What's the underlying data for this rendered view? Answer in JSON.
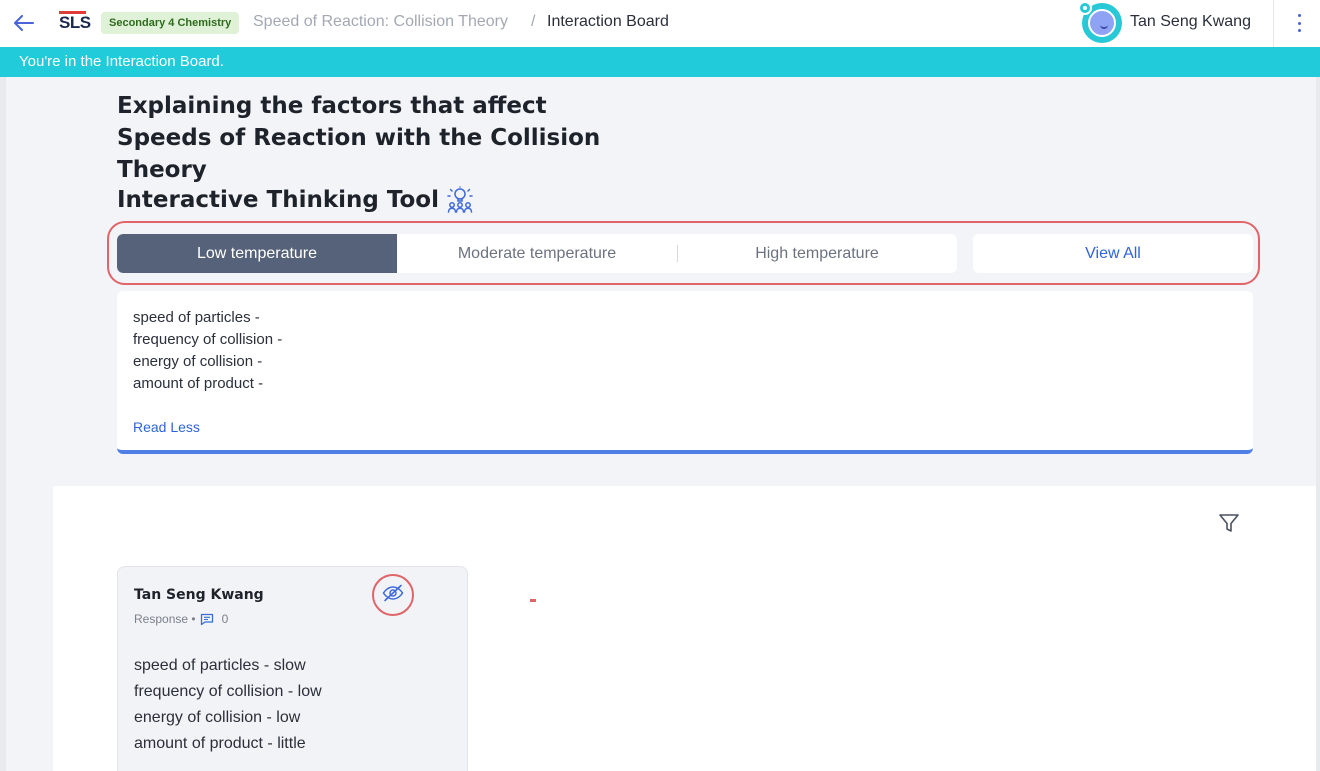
{
  "header": {
    "logo_text": "SLS",
    "subject_tag": "Secondary 4 Chemistry",
    "lesson_title": "Speed of Reaction: Collision Theory",
    "separator": "/",
    "current_page": "Interaction Board",
    "user_name": "Tan Seng Kwang",
    "icons": [
      "back-arrow-icon",
      "avatar",
      "more-vert-icon"
    ]
  },
  "banner": {
    "text": "You're in the Interaction Board."
  },
  "main": {
    "title": "Explaining the factors that affect Speeds of Reaction with the Collision Theory",
    "tool_title": "Interactive Thinking Tool",
    "tool_icon": "brainstorm-icon",
    "tabs": [
      {
        "label": "Low temperature",
        "active": true
      },
      {
        "label": "Moderate temperature",
        "active": false
      },
      {
        "label": "High temperature",
        "active": false
      }
    ],
    "view_all_label": "View All",
    "prompt": {
      "lines": [
        "speed of particles -",
        "frequency of collision -",
        "energy of collision -",
        "amount of product -"
      ],
      "toggle_label": "Read Less"
    }
  },
  "board": {
    "filter_icon": "filter-icon",
    "response": {
      "author": "Tan Seng Kwang",
      "type_label": "Response •",
      "comment_count": "0",
      "hide_icon": "eye-off-icon",
      "lines": [
        "speed of particles - slow",
        "frequency of collision - low",
        "energy of collision - low",
        "amount of product - little"
      ]
    }
  },
  "colors": {
    "banner": "#22cbd9",
    "active_tab": "#56627a",
    "link": "#2f63d6",
    "highlight": "#e06468",
    "accent_bar": "#4f7fe6",
    "subject_tag_bg": "#dff1d6"
  }
}
